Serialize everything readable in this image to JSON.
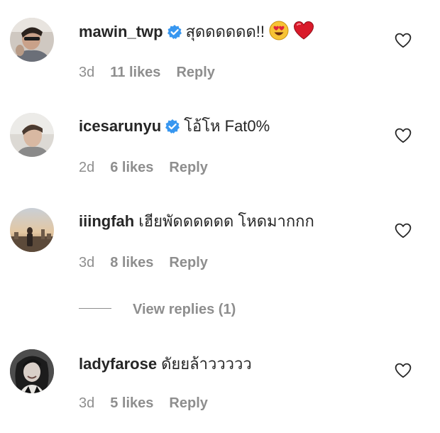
{
  "comments": [
    {
      "username": "mawin_twp",
      "verified": true,
      "text": "สุดดดดดด!!",
      "emojis": [
        "heart-eyes-emoji",
        "red-heart-emoji"
      ],
      "time": "3d",
      "likes": "11 likes",
      "reply": "Reply"
    },
    {
      "username": "icesarunyu",
      "verified": true,
      "text": "โอ้โห Fat0%",
      "time": "2d",
      "likes": "6 likes",
      "reply": "Reply"
    },
    {
      "username": "iiingfah",
      "verified": false,
      "text": "เฮียพัดดดดดด โหดมากกก",
      "time": "3d",
      "likes": "8 likes",
      "reply": "Reply"
    },
    {
      "username": "ladyfarose",
      "verified": false,
      "text": "ดัยยล้าววววว",
      "time": "3d",
      "likes": "5 likes",
      "reply": "Reply"
    }
  ],
  "view_replies": "View replies (1)",
  "colors": {
    "text": "#262626",
    "secondary": "#8e8e8e",
    "verified": "#3897f0",
    "heart_red": "#ed4956"
  }
}
